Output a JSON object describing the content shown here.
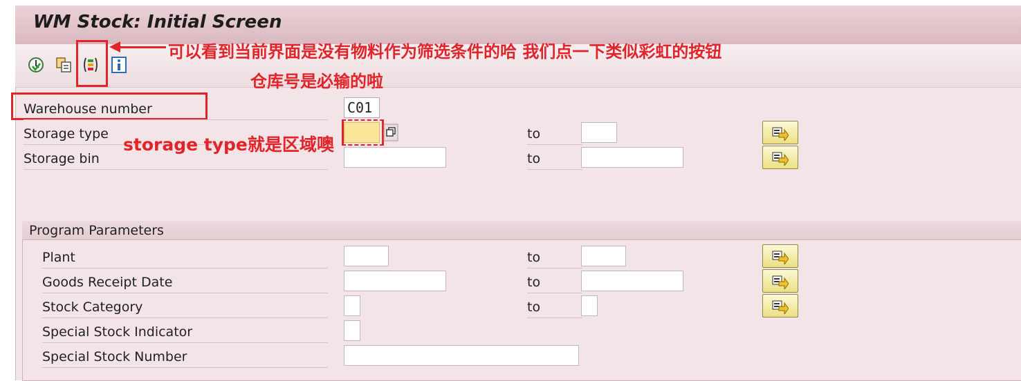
{
  "window": {
    "title": "WM Stock: Initial Screen"
  },
  "toolbar": {
    "icons": [
      "execute-icon",
      "get-variant-icon",
      "dynamic-selections-icon",
      "info-icon"
    ]
  },
  "annotations": {
    "arrow_note": "可以看到当前界面是没有物料作为筛选条件的哈 我们点一下类似彩虹的按钮",
    "warehouse_note": "仓库号是必输的啦",
    "storage_type_note": "storage type就是区域噢"
  },
  "selection": {
    "warehouse_label": "Warehouse number",
    "warehouse_value": "C01",
    "storage_type_label": "Storage type",
    "storage_bin_label": "Storage bin",
    "to_label": "to"
  },
  "program_parameters": {
    "title": "Program Parameters",
    "plant_label": "Plant",
    "gr_date_label": "Goods Receipt Date",
    "stock_category_label": "Stock Category",
    "special_stock_indicator_label": "Special Stock Indicator",
    "special_stock_number_label": "Special Stock Number",
    "to_label": "to"
  },
  "colors": {
    "annotation_red": "#e0242a",
    "background_pink": "#f3e4e7",
    "required_field": "#fbe59a"
  }
}
